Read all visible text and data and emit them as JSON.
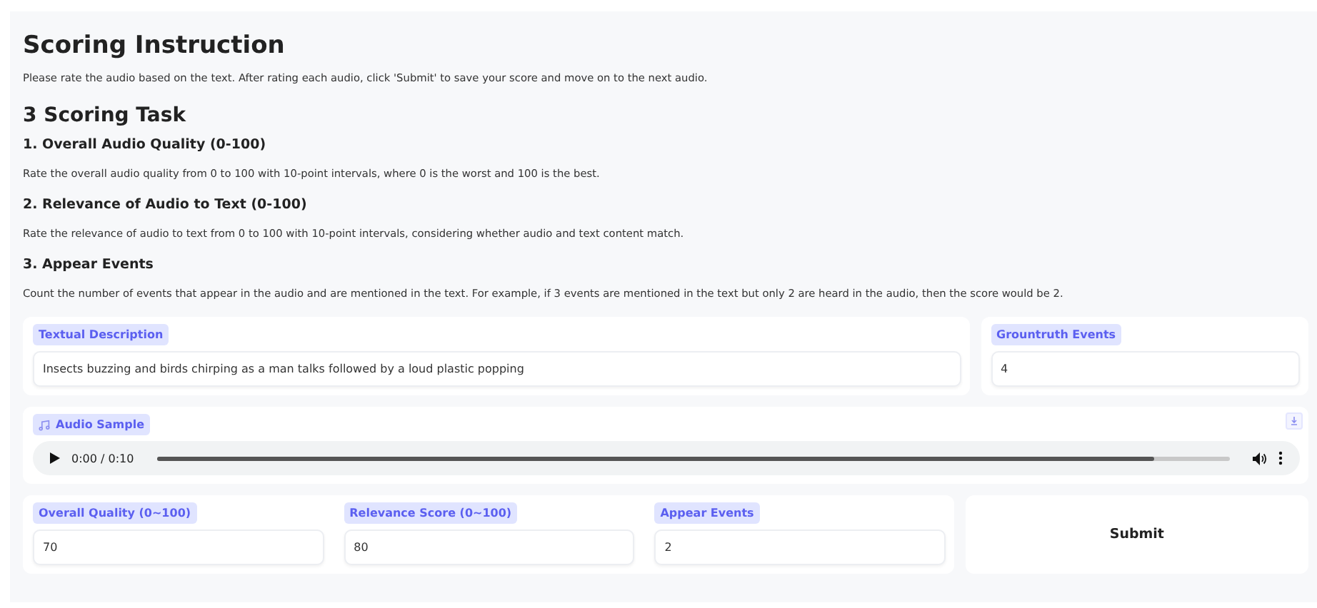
{
  "title": "Scoring Instruction",
  "intro": "Please rate the audio based on the text. After rating each audio, click 'Submit' to save your score and move on to the next audio.",
  "task_heading": "3 Scoring Task",
  "criteria": [
    {
      "heading": "1. Overall Audio Quality (0-100)",
      "text": "Rate the overall audio quality from 0 to 100 with 10-point intervals, where 0 is the worst and 100 is the best."
    },
    {
      "heading": "2. Relevance of Audio to Text (0-100)",
      "text": "Rate the relevance of audio to text from 0 to 100 with 10-point intervals, considering whether audio and text content match."
    },
    {
      "heading": "3. Appear Events",
      "text": "Count the number of events that appear in the audio and are mentioned in the text. For example, if 3 events are mentioned in the text but only 2 are heard in the audio, then the score would be 2."
    }
  ],
  "description": {
    "label": "Textual Description",
    "value": "Insects buzzing and birds chirping as a man talks followed by a loud plastic popping"
  },
  "groundtruth": {
    "label": "Grountruth Events",
    "value": "4"
  },
  "audio": {
    "label": "Audio Sample",
    "time": "0:00 / 0:10",
    "level": 0.93
  },
  "scores": [
    {
      "label": "Overall Quality (0~100)",
      "value": "70"
    },
    {
      "label": "Relevance Score (0~100)",
      "value": "80"
    },
    {
      "label": "Appear Events",
      "value": "2"
    }
  ],
  "submit": "Submit"
}
